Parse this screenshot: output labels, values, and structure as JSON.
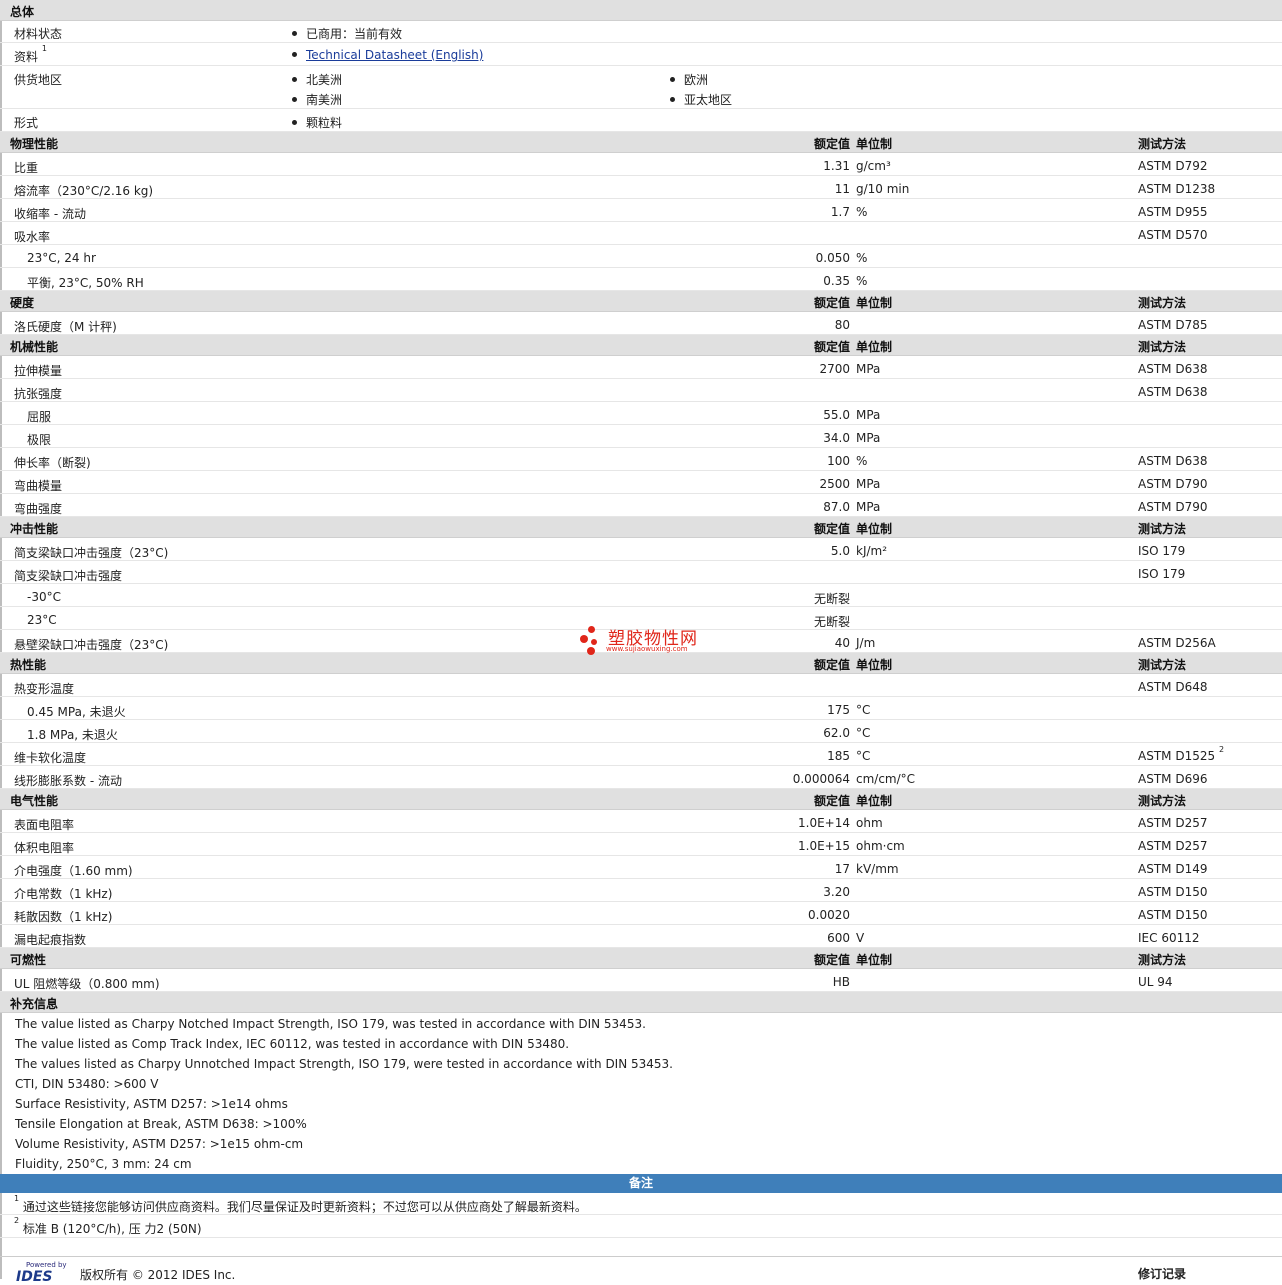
{
  "general": {
    "title": "总体",
    "rows": [
      {
        "label": "材料状态",
        "items": [
          "已商用：当前有效"
        ]
      },
      {
        "label": "资料",
        "sup": "1",
        "link": "Technical Datasheet (English)"
      },
      {
        "label": "供货地区",
        "col1": [
          "北美洲",
          "南美洲"
        ],
        "col2": [
          "欧洲",
          "亚太地区"
        ]
      },
      {
        "label": "形式",
        "items": [
          "颗粒料"
        ]
      }
    ]
  },
  "headers": {
    "nominal": "额定值",
    "unit": "单位制",
    "test": "测试方法"
  },
  "sections": [
    {
      "title": "物理性能",
      "rows": [
        {
          "prop": "比重",
          "val": "1.31",
          "unit": "g/cm³",
          "test": "ASTM D792"
        },
        {
          "prop": "熔流率（230°C/2.16 kg)",
          "val": "11",
          "unit": "g/10 min",
          "test": "ASTM D1238"
        },
        {
          "prop": "收缩率 - 流动",
          "val": "1.7",
          "unit": "%",
          "test": "ASTM D955"
        },
        {
          "prop": "吸水率",
          "val": "",
          "unit": "",
          "test": "ASTM D570"
        },
        {
          "prop": "23°C, 24 hr",
          "sub": true,
          "val": "0.050",
          "unit": "%",
          "test": ""
        },
        {
          "prop": "平衡, 23°C, 50% RH",
          "sub": true,
          "val": "0.35",
          "unit": "%",
          "test": ""
        }
      ]
    },
    {
      "title": "硬度",
      "rows": [
        {
          "prop": "洛氏硬度（M 计秤)",
          "val": "80",
          "unit": "",
          "test": "ASTM D785"
        }
      ]
    },
    {
      "title": "机械性能",
      "rows": [
        {
          "prop": "拉伸模量",
          "val": "2700",
          "unit": "MPa",
          "test": "ASTM D638"
        },
        {
          "prop": "抗张强度",
          "val": "",
          "unit": "",
          "test": "ASTM D638"
        },
        {
          "prop": "屈服",
          "sub": true,
          "val": "55.0",
          "unit": "MPa",
          "test": ""
        },
        {
          "prop": "极限",
          "sub": true,
          "val": "34.0",
          "unit": "MPa",
          "test": ""
        },
        {
          "prop": "伸长率（断裂)",
          "val": "100",
          "unit": "%",
          "test": "ASTM D638"
        },
        {
          "prop": "弯曲模量",
          "val": "2500",
          "unit": "MPa",
          "test": "ASTM D790"
        },
        {
          "prop": "弯曲强度",
          "val": "87.0",
          "unit": "MPa",
          "test": "ASTM D790"
        }
      ]
    },
    {
      "title": "冲击性能",
      "rows": [
        {
          "prop": "简支梁缺口冲击强度（23°C)",
          "val": "5.0",
          "unit": "kJ/m²",
          "test": "ISO 179"
        },
        {
          "prop": "简支梁缺口冲击强度",
          "val": "",
          "unit": "",
          "test": "ISO 179"
        },
        {
          "prop": "-30°C",
          "sub": true,
          "val": "无断裂",
          "unit": "",
          "test": ""
        },
        {
          "prop": "23°C",
          "sub": true,
          "val": "无断裂",
          "unit": "",
          "test": ""
        },
        {
          "prop": "悬壁梁缺口冲击强度（23°C)",
          "val": "40",
          "unit": "J/m",
          "test": "ASTM D256A"
        }
      ]
    },
    {
      "title": "热性能",
      "rows": [
        {
          "prop": "热变形温度",
          "val": "",
          "unit": "",
          "test": "ASTM D648"
        },
        {
          "prop": "0.45 MPa, 未退火",
          "sub": true,
          "val": "175",
          "unit": "°C",
          "test": ""
        },
        {
          "prop": "1.8 MPa, 未退火",
          "sub": true,
          "val": "62.0",
          "unit": "°C",
          "test": ""
        },
        {
          "prop": "维卡软化温度",
          "val": "185",
          "unit": "°C",
          "test": "ASTM D1525",
          "test_sup": "2"
        },
        {
          "prop": "线形膨胀系数 - 流动",
          "val": "0.000064",
          "unit": "cm/cm/°C",
          "test": "ASTM D696"
        }
      ]
    },
    {
      "title": "电气性能",
      "rows": [
        {
          "prop": "表面电阻率",
          "val": "1.0E+14",
          "unit": "ohm",
          "test": "ASTM D257"
        },
        {
          "prop": "体积电阻率",
          "val": "1.0E+15",
          "unit": "ohm·cm",
          "test": "ASTM D257"
        },
        {
          "prop": "介电强度（1.60 mm)",
          "val": "17",
          "unit": "kV/mm",
          "test": "ASTM D149"
        },
        {
          "prop": "介电常数（1 kHz)",
          "val": "3.20",
          "unit": "",
          "test": "ASTM D150"
        },
        {
          "prop": "耗散因数（1 kHz)",
          "val": "0.0020",
          "unit": "",
          "test": "ASTM D150"
        },
        {
          "prop": "漏电起痕指数",
          "val": "600",
          "unit": "V",
          "test": "IEC 60112"
        }
      ]
    },
    {
      "title": "可燃性",
      "rows": [
        {
          "prop": "UL 阻燃等级（0.800 mm)",
          "val": "HB",
          "unit": "",
          "test": "UL 94"
        }
      ]
    }
  ],
  "supplemental": {
    "title": "补充信息",
    "lines": [
      "The value listed as Charpy Notched Impact Strength, ISO 179, was tested in accordance with DIN 53453.",
      "The value listed as Comp Track Index, IEC 60112, was tested in accordance with DIN 53480.",
      "The values listed as Charpy Unnotched Impact Strength, ISO 179, were tested in accordance with DIN 53453.",
      "CTI, DIN 53480: >600 V",
      "Surface Resistivity, ASTM D257: >1e14 ohms",
      "Tensile Elongation at Break, ASTM D638: >100%",
      "Volume Resistivity, ASTM D257: >1e15 ohm-cm",
      "Fluidity, 250°C, 3 mm: 24 cm"
    ]
  },
  "notes": {
    "title": "备注",
    "items": [
      {
        "sup": "1",
        "text": "通过这些链接您能够访问供应商资料。我们尽量保证及时更新资料；不过您可以从供应商处了解最新资料。"
      },
      {
        "sup": "2",
        "text": "标准 B (120°C/h), 压 力2 (50N)"
      }
    ]
  },
  "watermark": {
    "title": "塑胶物性网",
    "url": "www.sujiaowuxing.com"
  },
  "footer": {
    "powered_by": "Powered by",
    "logo": "IDES",
    "copyright": "版权所有 © 2012 IDES Inc.",
    "revision": "修订记录"
  }
}
